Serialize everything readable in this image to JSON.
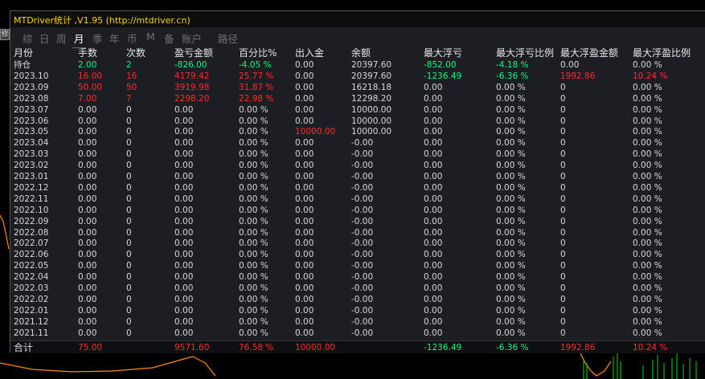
{
  "window": {
    "title": "MTDriver统计 ,V1.95 (http://mtdriver.cn)",
    "side_button_label": "修"
  },
  "tabs": [
    {
      "label": "综",
      "active": false
    },
    {
      "label": "日",
      "active": false
    },
    {
      "label": "周",
      "active": false
    },
    {
      "label": "月",
      "active": true
    },
    {
      "label": "季",
      "active": false
    },
    {
      "label": "年",
      "active": false
    },
    {
      "label": "币",
      "active": false
    },
    {
      "label": "M",
      "active": false
    },
    {
      "label": "备",
      "active": false
    },
    {
      "label": "账户",
      "active": false
    },
    {
      "label": "路径",
      "active": false
    }
  ],
  "columns": [
    "月份",
    "手数",
    "次数",
    "盈亏金额",
    "百分比%",
    "出入金",
    "余额",
    "最大浮亏",
    "最大浮亏比例",
    "最大浮盈金额",
    "最大浮盈比例"
  ],
  "colors": {
    "green": "#00ff7f",
    "red": "#ff2a2a",
    "white": "#d8d8d8",
    "title": "#ffd700"
  },
  "rows": [
    {
      "month": "持仓",
      "lots": "2.00",
      "lots_c": "green",
      "count": "2",
      "count_c": "green",
      "pl": "-826.00",
      "pl_c": "green",
      "pct": "-4.05 %",
      "pct_c": "green",
      "flow": "0.00",
      "flow_c": "white",
      "balance": "20397.60",
      "maxloss": "-852.00",
      "maxloss_c": "green",
      "maxloss_pct": "-4.18 %",
      "maxloss_pct_c": "green",
      "maxprofit": "0.00",
      "maxprofit_c": "white",
      "maxprofit_pct": "0.00 %",
      "maxprofit_pct_c": "white"
    },
    {
      "month": "2023.10",
      "lots": "16.00",
      "lots_c": "red",
      "count": "16",
      "count_c": "red",
      "pl": "4179.42",
      "pl_c": "red",
      "pct": "25.77 %",
      "pct_c": "red",
      "flow": "0.00",
      "flow_c": "white",
      "balance": "20397.60",
      "maxloss": "-1236.49",
      "maxloss_c": "green",
      "maxloss_pct": "-6.36 %",
      "maxloss_pct_c": "green",
      "maxprofit": "1992.86",
      "maxprofit_c": "red",
      "maxprofit_pct": "10.24 %",
      "maxprofit_pct_c": "red"
    },
    {
      "month": "2023.09",
      "lots": "50.00",
      "lots_c": "red",
      "count": "50",
      "count_c": "red",
      "pl": "3919.98",
      "pl_c": "red",
      "pct": "31.87 %",
      "pct_c": "red",
      "flow": "0.00",
      "flow_c": "white",
      "balance": "16218.18",
      "maxloss": "0.00",
      "maxloss_c": "white",
      "maxloss_pct": "0.00 %",
      "maxloss_pct_c": "white",
      "maxprofit": "0",
      "maxprofit_c": "white",
      "maxprofit_pct": "0.00 %",
      "maxprofit_pct_c": "white"
    },
    {
      "month": "2023.08",
      "lots": "7.00",
      "lots_c": "red",
      "count": "7",
      "count_c": "red",
      "pl": "2298.20",
      "pl_c": "red",
      "pct": "22.98 %",
      "pct_c": "red",
      "flow": "0.00",
      "flow_c": "white",
      "balance": "12298.20",
      "maxloss": "0.00",
      "maxloss_c": "white",
      "maxloss_pct": "0.00 %",
      "maxloss_pct_c": "white",
      "maxprofit": "0",
      "maxprofit_c": "white",
      "maxprofit_pct": "0.00 %",
      "maxprofit_pct_c": "white"
    },
    {
      "month": "2023.07",
      "lots": "0.00",
      "lots_c": "white",
      "count": "0",
      "count_c": "white",
      "pl": "0.00",
      "pl_c": "white",
      "pct": "0.00 %",
      "pct_c": "white",
      "flow": "0.00",
      "flow_c": "white",
      "balance": "10000.00",
      "maxloss": "0.00",
      "maxloss_c": "white",
      "maxloss_pct": "0.00 %",
      "maxloss_pct_c": "white",
      "maxprofit": "0",
      "maxprofit_c": "white",
      "maxprofit_pct": "0.00 %",
      "maxprofit_pct_c": "white"
    },
    {
      "month": "2023.06",
      "lots": "0.00",
      "lots_c": "white",
      "count": "0",
      "count_c": "white",
      "pl": "0.00",
      "pl_c": "white",
      "pct": "0.00 %",
      "pct_c": "white",
      "flow": "0.00",
      "flow_c": "white",
      "balance": "10000.00",
      "maxloss": "0.00",
      "maxloss_c": "white",
      "maxloss_pct": "0.00 %",
      "maxloss_pct_c": "white",
      "maxprofit": "0",
      "maxprofit_c": "white",
      "maxprofit_pct": "0.00 %",
      "maxprofit_pct_c": "white"
    },
    {
      "month": "2023.05",
      "lots": "0.00",
      "lots_c": "white",
      "count": "0",
      "count_c": "white",
      "pl": "0.00",
      "pl_c": "white",
      "pct": "0.00 %",
      "pct_c": "white",
      "flow": "10000.00",
      "flow_c": "red",
      "balance": "10000.00",
      "maxloss": "0.00",
      "maxloss_c": "white",
      "maxloss_pct": "0.00 %",
      "maxloss_pct_c": "white",
      "maxprofit": "0",
      "maxprofit_c": "white",
      "maxprofit_pct": "0.00 %",
      "maxprofit_pct_c": "white"
    },
    {
      "month": "2023.04",
      "lots": "0.00",
      "lots_c": "white",
      "count": "0",
      "count_c": "white",
      "pl": "0.00",
      "pl_c": "white",
      "pct": "0.00 %",
      "pct_c": "white",
      "flow": "0.00",
      "flow_c": "white",
      "balance": "-0.00",
      "maxloss": "0.00",
      "maxloss_c": "white",
      "maxloss_pct": "0.00 %",
      "maxloss_pct_c": "white",
      "maxprofit": "0",
      "maxprofit_c": "white",
      "maxprofit_pct": "0.00 %",
      "maxprofit_pct_c": "white"
    },
    {
      "month": "2023.03",
      "lots": "0.00",
      "lots_c": "white",
      "count": "0",
      "count_c": "white",
      "pl": "0.00",
      "pl_c": "white",
      "pct": "0.00 %",
      "pct_c": "white",
      "flow": "0.00",
      "flow_c": "white",
      "balance": "-0.00",
      "maxloss": "0.00",
      "maxloss_c": "white",
      "maxloss_pct": "0.00 %",
      "maxloss_pct_c": "white",
      "maxprofit": "0",
      "maxprofit_c": "white",
      "maxprofit_pct": "0.00 %",
      "maxprofit_pct_c": "white"
    },
    {
      "month": "2023.02",
      "lots": "0.00",
      "lots_c": "white",
      "count": "0",
      "count_c": "white",
      "pl": "0.00",
      "pl_c": "white",
      "pct": "0.00 %",
      "pct_c": "white",
      "flow": "0.00",
      "flow_c": "white",
      "balance": "-0.00",
      "maxloss": "0.00",
      "maxloss_c": "white",
      "maxloss_pct": "0.00 %",
      "maxloss_pct_c": "white",
      "maxprofit": "0",
      "maxprofit_c": "white",
      "maxprofit_pct": "0.00 %",
      "maxprofit_pct_c": "white"
    },
    {
      "month": "2023.01",
      "lots": "0.00",
      "lots_c": "white",
      "count": "0",
      "count_c": "white",
      "pl": "0.00",
      "pl_c": "white",
      "pct": "0.00 %",
      "pct_c": "white",
      "flow": "0.00",
      "flow_c": "white",
      "balance": "-0.00",
      "maxloss": "0.00",
      "maxloss_c": "white",
      "maxloss_pct": "0.00 %",
      "maxloss_pct_c": "white",
      "maxprofit": "0",
      "maxprofit_c": "white",
      "maxprofit_pct": "0.00 %",
      "maxprofit_pct_c": "white"
    },
    {
      "month": "2022.12",
      "lots": "0.00",
      "lots_c": "white",
      "count": "0",
      "count_c": "white",
      "pl": "0.00",
      "pl_c": "white",
      "pct": "0.00 %",
      "pct_c": "white",
      "flow": "0.00",
      "flow_c": "white",
      "balance": "-0.00",
      "maxloss": "0.00",
      "maxloss_c": "white",
      "maxloss_pct": "0.00 %",
      "maxloss_pct_c": "white",
      "maxprofit": "0",
      "maxprofit_c": "white",
      "maxprofit_pct": "0.00 %",
      "maxprofit_pct_c": "white"
    },
    {
      "month": "2022.11",
      "lots": "0.00",
      "lots_c": "white",
      "count": "0",
      "count_c": "white",
      "pl": "0.00",
      "pl_c": "white",
      "pct": "0.00 %",
      "pct_c": "white",
      "flow": "0.00",
      "flow_c": "white",
      "balance": "-0.00",
      "maxloss": "0.00",
      "maxloss_c": "white",
      "maxloss_pct": "0.00 %",
      "maxloss_pct_c": "white",
      "maxprofit": "0",
      "maxprofit_c": "white",
      "maxprofit_pct": "0.00 %",
      "maxprofit_pct_c": "white"
    },
    {
      "month": "2022.10",
      "lots": "0.00",
      "lots_c": "white",
      "count": "0",
      "count_c": "white",
      "pl": "0.00",
      "pl_c": "white",
      "pct": "0.00 %",
      "pct_c": "white",
      "flow": "0.00",
      "flow_c": "white",
      "balance": "-0.00",
      "maxloss": "0.00",
      "maxloss_c": "white",
      "maxloss_pct": "0.00 %",
      "maxloss_pct_c": "white",
      "maxprofit": "0",
      "maxprofit_c": "white",
      "maxprofit_pct": "0.00 %",
      "maxprofit_pct_c": "white"
    },
    {
      "month": "2022.09",
      "lots": "0.00",
      "lots_c": "white",
      "count": "0",
      "count_c": "white",
      "pl": "0.00",
      "pl_c": "white",
      "pct": "0.00 %",
      "pct_c": "white",
      "flow": "0.00",
      "flow_c": "white",
      "balance": "-0.00",
      "maxloss": "0.00",
      "maxloss_c": "white",
      "maxloss_pct": "0.00 %",
      "maxloss_pct_c": "white",
      "maxprofit": "0",
      "maxprofit_c": "white",
      "maxprofit_pct": "0.00 %",
      "maxprofit_pct_c": "white"
    },
    {
      "month": "2022.08",
      "lots": "0.00",
      "lots_c": "white",
      "count": "0",
      "count_c": "white",
      "pl": "0.00",
      "pl_c": "white",
      "pct": "0.00 %",
      "pct_c": "white",
      "flow": "0.00",
      "flow_c": "white",
      "balance": "-0.00",
      "maxloss": "0.00",
      "maxloss_c": "white",
      "maxloss_pct": "0.00 %",
      "maxloss_pct_c": "white",
      "maxprofit": "0",
      "maxprofit_c": "white",
      "maxprofit_pct": "0.00 %",
      "maxprofit_pct_c": "white"
    },
    {
      "month": "2022.07",
      "lots": "0.00",
      "lots_c": "white",
      "count": "0",
      "count_c": "white",
      "pl": "0.00",
      "pl_c": "white",
      "pct": "0.00 %",
      "pct_c": "white",
      "flow": "0.00",
      "flow_c": "white",
      "balance": "-0.00",
      "maxloss": "0.00",
      "maxloss_c": "white",
      "maxloss_pct": "0.00 %",
      "maxloss_pct_c": "white",
      "maxprofit": "0",
      "maxprofit_c": "white",
      "maxprofit_pct": "0.00 %",
      "maxprofit_pct_c": "white"
    },
    {
      "month": "2022.06",
      "lots": "0.00",
      "lots_c": "white",
      "count": "0",
      "count_c": "white",
      "pl": "0.00",
      "pl_c": "white",
      "pct": "0.00 %",
      "pct_c": "white",
      "flow": "0.00",
      "flow_c": "white",
      "balance": "-0.00",
      "maxloss": "0.00",
      "maxloss_c": "white",
      "maxloss_pct": "0.00 %",
      "maxloss_pct_c": "white",
      "maxprofit": "0",
      "maxprofit_c": "white",
      "maxprofit_pct": "0.00 %",
      "maxprofit_pct_c": "white"
    },
    {
      "month": "2022.05",
      "lots": "0.00",
      "lots_c": "white",
      "count": "0",
      "count_c": "white",
      "pl": "0.00",
      "pl_c": "white",
      "pct": "0.00 %",
      "pct_c": "white",
      "flow": "0.00",
      "flow_c": "white",
      "balance": "-0.00",
      "maxloss": "0.00",
      "maxloss_c": "white",
      "maxloss_pct": "0.00 %",
      "maxloss_pct_c": "white",
      "maxprofit": "0",
      "maxprofit_c": "white",
      "maxprofit_pct": "0.00 %",
      "maxprofit_pct_c": "white"
    },
    {
      "month": "2022.04",
      "lots": "0.00",
      "lots_c": "white",
      "count": "0",
      "count_c": "white",
      "pl": "0.00",
      "pl_c": "white",
      "pct": "0.00 %",
      "pct_c": "white",
      "flow": "0.00",
      "flow_c": "white",
      "balance": "-0.00",
      "maxloss": "0.00",
      "maxloss_c": "white",
      "maxloss_pct": "0.00 %",
      "maxloss_pct_c": "white",
      "maxprofit": "0",
      "maxprofit_c": "white",
      "maxprofit_pct": "0.00 %",
      "maxprofit_pct_c": "white"
    },
    {
      "month": "2022.03",
      "lots": "0.00",
      "lots_c": "white",
      "count": "0",
      "count_c": "white",
      "pl": "0.00",
      "pl_c": "white",
      "pct": "0.00 %",
      "pct_c": "white",
      "flow": "0.00",
      "flow_c": "white",
      "balance": "-0.00",
      "maxloss": "0.00",
      "maxloss_c": "white",
      "maxloss_pct": "0.00 %",
      "maxloss_pct_c": "white",
      "maxprofit": "0",
      "maxprofit_c": "white",
      "maxprofit_pct": "0.00 %",
      "maxprofit_pct_c": "white"
    },
    {
      "month": "2022.02",
      "lots": "0.00",
      "lots_c": "white",
      "count": "0",
      "count_c": "white",
      "pl": "0.00",
      "pl_c": "white",
      "pct": "0.00 %",
      "pct_c": "white",
      "flow": "0.00",
      "flow_c": "white",
      "balance": "-0.00",
      "maxloss": "0.00",
      "maxloss_c": "white",
      "maxloss_pct": "0.00 %",
      "maxloss_pct_c": "white",
      "maxprofit": "0",
      "maxprofit_c": "white",
      "maxprofit_pct": "0.00 %",
      "maxprofit_pct_c": "white"
    },
    {
      "month": "2022.01",
      "lots": "0.00",
      "lots_c": "white",
      "count": "0",
      "count_c": "white",
      "pl": "0.00",
      "pl_c": "white",
      "pct": "0.00 %",
      "pct_c": "white",
      "flow": "0.00",
      "flow_c": "white",
      "balance": "-0.00",
      "maxloss": "0.00",
      "maxloss_c": "white",
      "maxloss_pct": "0.00 %",
      "maxloss_pct_c": "white",
      "maxprofit": "0",
      "maxprofit_c": "white",
      "maxprofit_pct": "0.00 %",
      "maxprofit_pct_c": "white"
    },
    {
      "month": "2021.12",
      "lots": "0.00",
      "lots_c": "white",
      "count": "0",
      "count_c": "white",
      "pl": "0.00",
      "pl_c": "white",
      "pct": "0.00 %",
      "pct_c": "white",
      "flow": "0.00",
      "flow_c": "white",
      "balance": "-0.00",
      "maxloss": "0.00",
      "maxloss_c": "white",
      "maxloss_pct": "0.00 %",
      "maxloss_pct_c": "white",
      "maxprofit": "0",
      "maxprofit_c": "white",
      "maxprofit_pct": "0.00 %",
      "maxprofit_pct_c": "white"
    },
    {
      "month": "2021.11",
      "lots": "0.00",
      "lots_c": "white",
      "count": "0",
      "count_c": "white",
      "pl": "0.00",
      "pl_c": "white",
      "pct": "0.00 %",
      "pct_c": "white",
      "flow": "0.00",
      "flow_c": "white",
      "balance": "-0.00",
      "maxloss": "0.00",
      "maxloss_c": "white",
      "maxloss_pct": "0.00 %",
      "maxloss_pct_c": "white",
      "maxprofit": "0",
      "maxprofit_c": "white",
      "maxprofit_pct": "0.00 %",
      "maxprofit_pct_c": "white"
    }
  ],
  "total": {
    "label": "合计",
    "lots": "75.00",
    "pl": "9571.60",
    "pct": "76.58 %",
    "flow": "10000.00",
    "maxloss": "-1236.49",
    "maxloss_pct": "-6.36 %",
    "maxprofit": "1992.86",
    "maxprofit_pct": "10.24 %"
  }
}
